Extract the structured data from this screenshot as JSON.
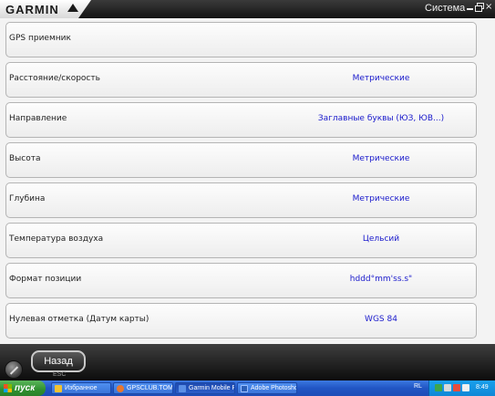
{
  "app": {
    "brand": "GARMIN",
    "window_title": "Система"
  },
  "settings": [
    {
      "label": "GPS приемник",
      "value": ""
    },
    {
      "label": "Расстояние/скорость",
      "value": "Метрические"
    },
    {
      "label": "Направление",
      "value": "Заглавные буквы (ЮЗ, ЮВ...)"
    },
    {
      "label": "Высота",
      "value": "Метрические"
    },
    {
      "label": "Глубина",
      "value": "Метрические"
    },
    {
      "label": "Температура воздуха",
      "value": "Цельсий"
    },
    {
      "label": "Формат позиции",
      "value": "hddd°mm'ss.s\""
    },
    {
      "label": "Нулевая отметка (Датум карты)",
      "value": "WGS 84"
    }
  ],
  "bottom": {
    "back_label": "Назад",
    "esc_label": "ESC"
  },
  "taskbar": {
    "start_label": "пуск",
    "tasks": [
      {
        "label": "Избранное"
      },
      {
        "label": "GPSCLUB.TOMS..."
      },
      {
        "label": "Garmin Mobile PC"
      },
      {
        "label": "Adobe Photoshop"
      }
    ],
    "language": "RL",
    "clock": "8:49"
  },
  "colors": {
    "value_text": "#1a1acc",
    "taskbar": "#245edb",
    "start": "#3c9a3c"
  },
  "icons": [
    "garmin-logo-icon",
    "minimize-icon",
    "restore-icon",
    "close-icon",
    "gps-round-icon",
    "windows-flag-icon"
  ]
}
